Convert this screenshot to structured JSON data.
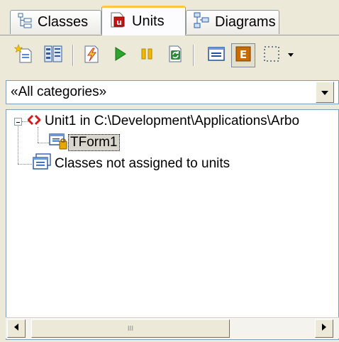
{
  "tabs": [
    {
      "label": "Classes",
      "icon": "class-tree-icon"
    },
    {
      "label": "Units",
      "icon": "unit-icon",
      "active": true
    },
    {
      "label": "Diagrams",
      "icon": "diagram-icon"
    }
  ],
  "toolbar": {
    "buttons": [
      "new-unit-icon",
      "class-properties-icon",
      "generate-code-icon",
      "run-icon",
      "pause-icon",
      "refresh-icon",
      "show-classes-icon",
      "show-events-icon",
      "dotted-frame-icon",
      "dropdown-arrow-icon"
    ],
    "pressed_button": "show-events-icon"
  },
  "category_filter": {
    "selected": "«All categories»"
  },
  "tree": {
    "unit_node": {
      "label": "Unit1 in C:\\Development\\Applications\\Arbo",
      "expanded": true
    },
    "form_node": {
      "label": "TForm1",
      "selected": true
    },
    "unassigned_node": {
      "label": "Classes not assigned to units"
    }
  },
  "scrollbar": {
    "grip": "III"
  },
  "colors": {
    "active_tab_accent": "#ffc83c",
    "unit_brackets_red": "#d01e1e",
    "run_green": "#2ba52b",
    "pause_yellow": "#f0b800",
    "events_orange": "#c86c00"
  }
}
